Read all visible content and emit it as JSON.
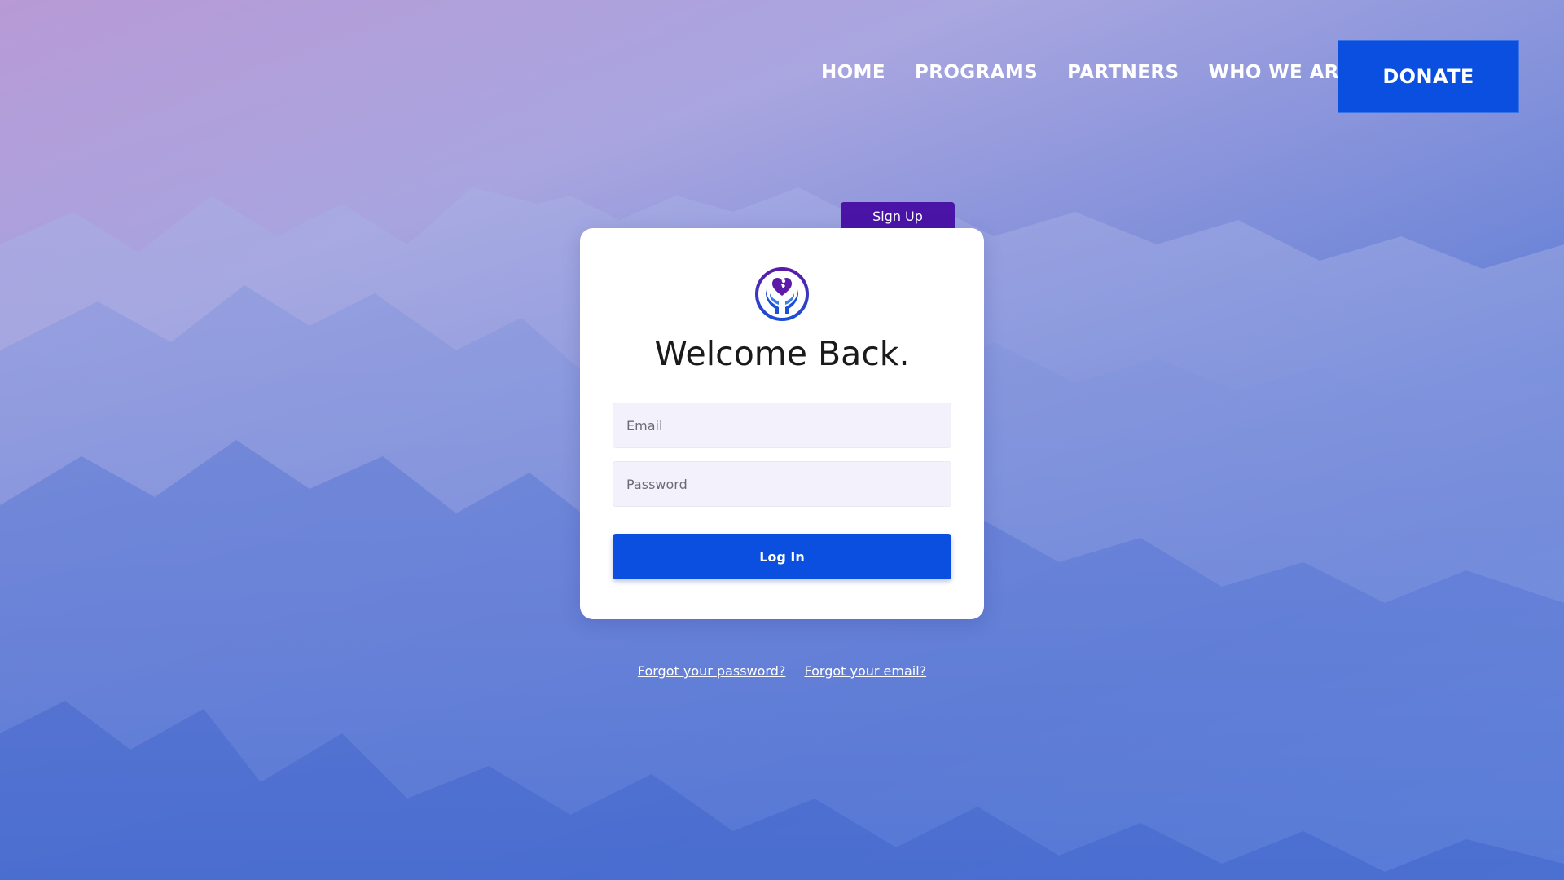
{
  "nav": {
    "items": [
      {
        "label": "HOME"
      },
      {
        "label": "PROGRAMS"
      },
      {
        "label": "PARTNERS"
      },
      {
        "label": "WHO WE ARE"
      }
    ],
    "donate_label": "DONATE"
  },
  "signup": {
    "label": "Sign Up"
  },
  "login": {
    "logo_icon": "heart-hands-icon",
    "title": "Welcome Back.",
    "email_placeholder": "Email",
    "password_placeholder": "Password",
    "submit_label": "Log In"
  },
  "links": {
    "forgot_password": "Forgot your password?",
    "forgot_email": "Forgot your email?"
  },
  "colors": {
    "primary": "#0a4fe0",
    "signup_tab": "#4a14a6",
    "logo_purple": "#5b1aa8",
    "logo_blue": "#1b4fd6",
    "field_bg": "#f3f1fb"
  }
}
